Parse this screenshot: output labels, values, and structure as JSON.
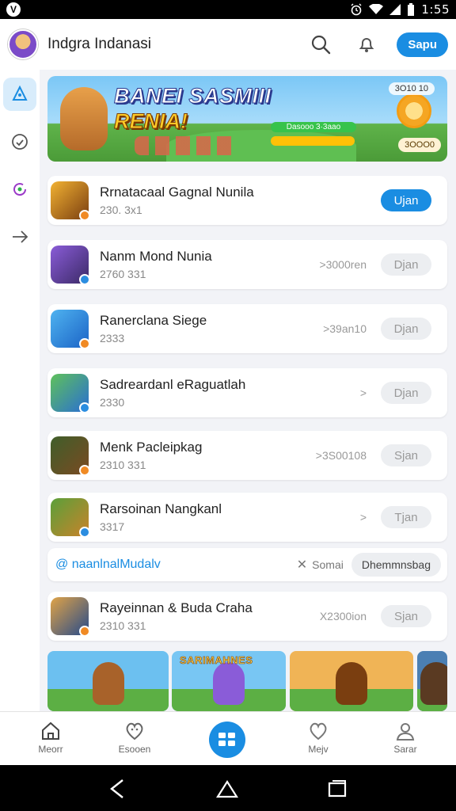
{
  "status_bar": {
    "time": "1:55",
    "app_glyph": "V",
    "icons": [
      "alarm-icon",
      "wifi-icon",
      "signal-icon",
      "battery-icon"
    ]
  },
  "header": {
    "title": "Indgra Indanasi",
    "action_label": "Sapu"
  },
  "rail": {
    "items": [
      "apps-icon",
      "game-controller-icon",
      "refresh-icon",
      "send-icon"
    ],
    "active_index": 0
  },
  "banner": {
    "title_line1": "BANEI SASMIII",
    "title_line2": "RENIA!",
    "chip": "3O10 10",
    "progress_text": "Dasooo 3·3aao",
    "badge": "3OOO0"
  },
  "apps": [
    {
      "name": "Rrnatacaal Gagnal Nunila",
      "sub": "230. 3x1",
      "meta": "",
      "button": "Ujan",
      "primary": true,
      "colors": [
        "#f2b233",
        "#7a3e10"
      ]
    },
    {
      "name": "Nanm Mond Nunia",
      "sub": "2760 331",
      "meta": ">3000ren",
      "button": "Djan",
      "primary": false,
      "colors": [
        "#8a5cd8",
        "#3b2a66"
      ]
    },
    {
      "name": "Ranerclana Siege",
      "sub": "2333",
      "meta": ">39an10",
      "button": "Djan",
      "primary": false,
      "colors": [
        "#4fb3f0",
        "#1b63c6"
      ]
    },
    {
      "name": "Sadreardanl eRaguatlah",
      "sub": "2330",
      "meta": ">",
      "button": "Djan",
      "primary": false,
      "colors": [
        "#5fc15a",
        "#2a6ed3"
      ]
    },
    {
      "name": "Menk Pacleipkag",
      "sub": "2310 331",
      "meta": ">3S00108",
      "button": "Sjan",
      "primary": false,
      "colors": [
        "#3f5e2a",
        "#7a4a22"
      ]
    },
    {
      "name": "Rarsoinan Nangkanl",
      "sub": "3317",
      "meta": ">",
      "button": "Tjan",
      "primary": false,
      "colors": [
        "#5aa03a",
        "#c9822a"
      ]
    },
    {
      "name": "Rayeinnan & Buda Craha",
      "sub": "2310 331",
      "meta": "X2300ion",
      "button": "Sjan",
      "primary": false,
      "colors": [
        "#e0a347",
        "#264a8a"
      ]
    }
  ],
  "tag_row": {
    "text": "@ naanlnalMudalv",
    "sort_label": "Somai",
    "chip": "Dhemmnsbag"
  },
  "thumbnails": [
    {
      "label": "",
      "sky": "#6cc0f0",
      "hero": "#a8622a"
    },
    {
      "label": "SARIMAHNES",
      "sky": "#78c6f3",
      "hero": "#8a5cd8"
    },
    {
      "label": "",
      "sky": "#f0b456",
      "hero": "#7a3e10"
    },
    {
      "label": "",
      "sky": "#4b7fb3",
      "hero": "#5a3a22"
    }
  ],
  "bottom_nav": {
    "items": [
      {
        "icon": "home-icon",
        "label": "Meorr"
      },
      {
        "icon": "heart-face-icon",
        "label": "Esooen"
      },
      {
        "icon": "grid-icon",
        "label": ""
      },
      {
        "icon": "heart-icon",
        "label": "Mejv"
      },
      {
        "icon": "profile-icon",
        "label": "Sarar"
      }
    ]
  },
  "colors": {
    "accent": "#1a8de2",
    "background": "#f2f3f7"
  }
}
